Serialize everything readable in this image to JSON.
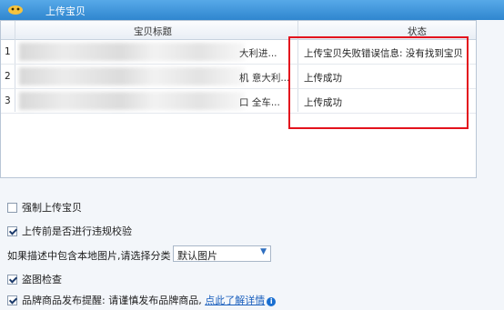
{
  "window": {
    "title": "上传宝贝"
  },
  "table": {
    "columns": [
      "宝贝标题",
      "状态"
    ],
    "rows": [
      {
        "num": "1",
        "title_tail": "大利进...",
        "status": "上传宝贝失败错误信息: 没有找到宝贝"
      },
      {
        "num": "2",
        "title_tail": "机 意大利...",
        "status": "上传成功"
      },
      {
        "num": "3",
        "title_tail": "口 全车...",
        "status": "上传成功"
      }
    ]
  },
  "options": {
    "force_upload": {
      "label": "强制上传宝贝",
      "checked": false
    },
    "violation_check": {
      "label": "上传前是否进行违规校验",
      "checked": true
    },
    "image_category": {
      "label": "如果描述中包含本地图片,请选择分类",
      "value": "默认图片"
    },
    "image_theft_check": {
      "label": "盗图检查",
      "checked": true
    },
    "brand_reminder": {
      "label": "品牌商品发布提醒: 请谨慎发布品牌商品,",
      "link": "点此了解详情",
      "checked": true
    }
  },
  "colors": {
    "titlebar": "#2f86cf",
    "highlight": "#e3121d",
    "link": "#1a5fbd"
  }
}
